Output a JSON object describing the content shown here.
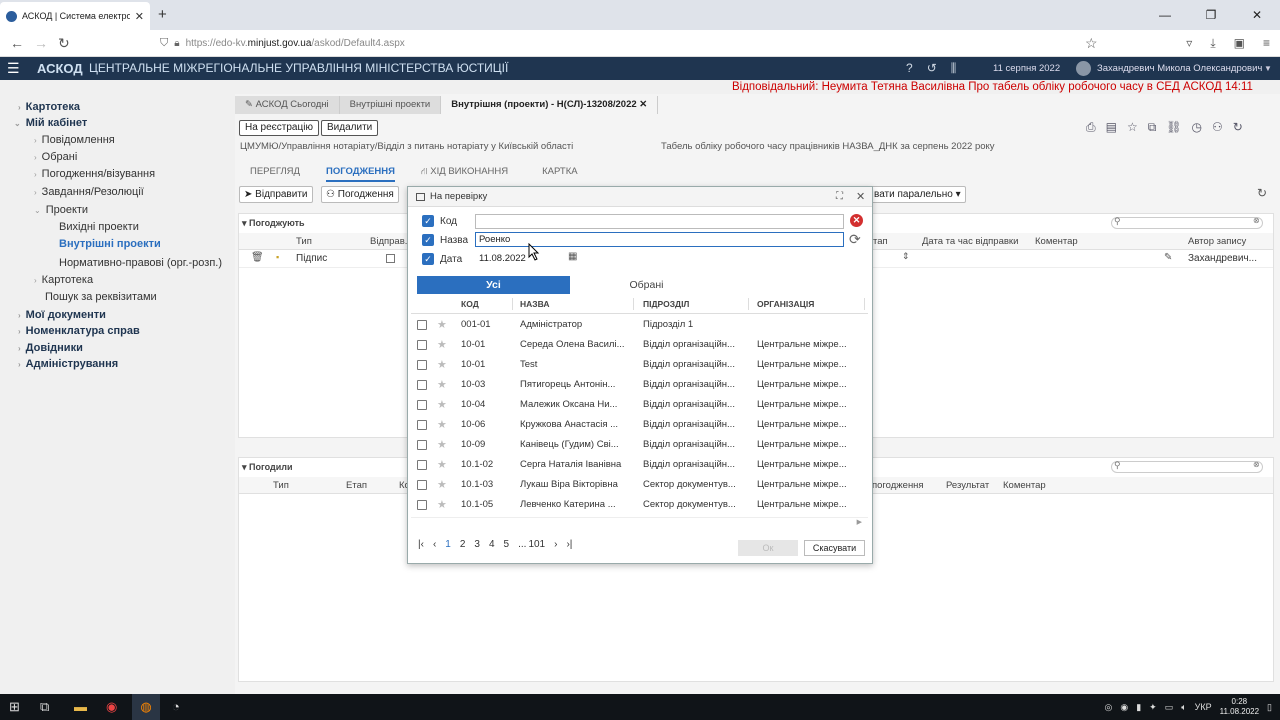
{
  "browser": {
    "tab_title": "АСКОД | Система електронно",
    "url_prefix": "https://edo-kv.",
    "url_domain": "minjust.gov.ua",
    "url_suffix": "/askod/Default4.aspx"
  },
  "header": {
    "logo": "АСКОД",
    "org": "ЦЕНТРАЛЬНЕ МІЖРЕГІОНАЛЬНЕ УПРАВЛІННЯ МІНІСТЕРСТВА ЮСТИЦІЇ",
    "date": "11 серпня 2022",
    "user": "Захандревич Микола Олександрович",
    "marquee": "Відповідальний: Неумита Тетяна Василівна Про табель обліку робочого часу в СЕД АСКОД 14:11"
  },
  "sidebar": {
    "kartoteka": "Картотека",
    "my_cabinet": "Мій кабінет",
    "notifications": "Повідомлення",
    "favorites": "Обрані",
    "approvals": "Погодження/візування",
    "tasks": "Завдання/Резолюції",
    "projects": "Проекти",
    "outgoing": "Вихідні проекти",
    "internal": "Внутрішні проекти",
    "normative": "Нормативно-правові (орг.-розп.)",
    "sub_kartoteka": "Картотека",
    "search_req": "Пошук за реквізитами",
    "my_docs": "Мої документи",
    "nomenclature": "Номенклатура справ",
    "references": "Довідники",
    "administration": "Адміністрування"
  },
  "main": {
    "tab1": "АСКОД Сьогодні",
    "tab2": "Внутрішні проекти",
    "tab3": "Внутрішня (проекти) - Н(СЛ)-13208/2022",
    "btn_register": "На реєстрацію",
    "btn_delete": "Видалити",
    "path": "ЦМУМЮ/Управління нотаріату/Відділ з питань нотаріату у Київській області",
    "doc_title": "Табель обліку робочого часу працівників НАЗВА_ДНК за серпень 2022 року",
    "subtab_review": "ПЕРЕГЛЯД",
    "subtab_approval": "ПОГОДЖЕННЯ",
    "subtab_progress": "ХІД ВИКОНАННЯ",
    "subtab_card": "КАРТКА",
    "btn_send": "Відправити",
    "btn_approval": "Погодження",
    "btn_parallel": "вати паралельно",
    "section_approving": "Погоджують",
    "col_type": "Тип",
    "col_send": "Відправ...",
    "col_stage": "тап",
    "col_datetime": "Дата та час відправки",
    "col_comment": "Коментар",
    "col_author": "Автор запису",
    "row_type": "Підпис",
    "row_author": "Захандревич...",
    "section_approved": "Погодили",
    "col2_type": "Тип",
    "col2_stage": "Етап",
    "col2_k": "Ко",
    "col2_approval": "погодження",
    "col2_result": "Результат",
    "col2_comment": "Коментар"
  },
  "dialog": {
    "title": "На перевірку",
    "label_code": "Код",
    "label_name": "Назва",
    "label_date": "Дата",
    "value_code": "",
    "value_name": "Роенко",
    "value_date": "11.08.2022",
    "tab_all": "Усі",
    "tab_fav": "Обрані",
    "headers": [
      "КОД",
      "НАЗВА",
      "ПІДРОЗДІЛ",
      "ОРГАНІЗАЦІЯ"
    ],
    "rows": [
      [
        "001-01",
        "Адміністратор",
        "Підрозділ 1",
        ""
      ],
      [
        "10-01",
        "Середа Олена Василі...",
        "Відділ організаційн...",
        "Центральне міжре..."
      ],
      [
        "10-01",
        "Test",
        "Відділ організаційн...",
        "Центральне міжре..."
      ],
      [
        "10-03",
        "Пятигорець Антонін...",
        "Відділ організаційн...",
        "Центральне міжре..."
      ],
      [
        "10-04",
        "Малежик Оксана Ни...",
        "Відділ організаційн...",
        "Центральне міжре..."
      ],
      [
        "10-06",
        "Кружкова Анастасія ...",
        "Відділ організаційн...",
        "Центральне міжре..."
      ],
      [
        "10-09",
        "Канівець (Гудим) Сві...",
        "Відділ організаційн...",
        "Центральне міжре..."
      ],
      [
        "10.1-02",
        "Серга Наталія Іванівна",
        "Відділ організаційн...",
        "Центральне міжре..."
      ],
      [
        "10.1-03",
        "Лукаш Віра Вікторівна",
        "Сектор документув...",
        "Центральне міжре..."
      ],
      [
        "10.1-05",
        "Левченко Катерина ...",
        "Сектор документув...",
        "Центральне міжре..."
      ]
    ],
    "pages": [
      "1",
      "2",
      "3",
      "4",
      "5",
      "...",
      "101"
    ],
    "btn_ok": "Ок",
    "btn_cancel": "Скасувати"
  },
  "taskbar": {
    "lang": "УКР",
    "time": "0:28",
    "date": "11.08.2022"
  }
}
